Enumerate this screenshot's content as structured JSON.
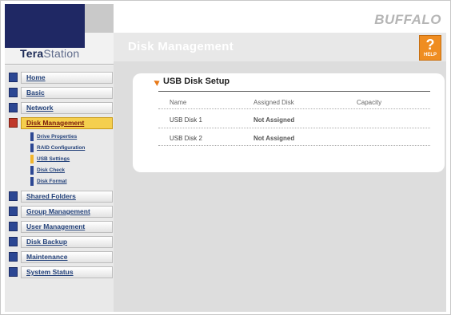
{
  "brand": "BUFFALO",
  "logo": {
    "part1": "Tera",
    "part2": "Station"
  },
  "page_title": "Disk Management",
  "help": {
    "symbol": "?",
    "label": "HELP"
  },
  "nav": {
    "items": [
      {
        "label": "Home",
        "icon": "home-icon"
      },
      {
        "label": "Basic",
        "icon": "basic-icon"
      },
      {
        "label": "Network",
        "icon": "network-icon"
      },
      {
        "label": "Disk Management",
        "icon": "disk-icon",
        "active": true
      },
      {
        "label": "Shared Folders",
        "icon": "folder-icon"
      },
      {
        "label": "Group Management",
        "icon": "group-icon"
      },
      {
        "label": "User Management",
        "icon": "user-icon"
      },
      {
        "label": "Disk Backup",
        "icon": "backup-icon"
      },
      {
        "label": "Maintenance",
        "icon": "maintenance-icon"
      },
      {
        "label": "System Status",
        "icon": "status-icon"
      }
    ],
    "subitems": [
      {
        "label": "Drive Properties"
      },
      {
        "label": "RAID Configuration"
      },
      {
        "label": "USB Settings",
        "selected": true
      },
      {
        "label": "Disk Check"
      },
      {
        "label": "Disk Format"
      }
    ]
  },
  "panel": {
    "title": "USB Disk Setup",
    "columns": [
      "Name",
      "Assigned Disk",
      "Capacity"
    ],
    "rows": [
      [
        "USB Disk 1",
        "Not Assigned",
        ""
      ],
      [
        "USB Disk 2",
        "Not Assigned",
        ""
      ]
    ]
  },
  "colors": {
    "logo_navy": "#1f2864",
    "active_nav": "#f5cf4e",
    "help_orange": "#ef8d21",
    "link_blue": "#24427a"
  }
}
